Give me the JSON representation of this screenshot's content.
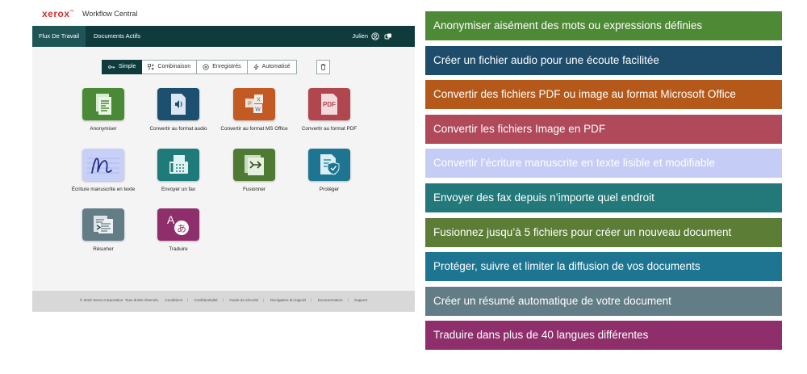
{
  "app": {
    "brand": "xerox",
    "brand_mark": "™",
    "product": "Workflow Central",
    "nav": {
      "tabs": [
        {
          "label": "Flux De Travail",
          "active": true
        },
        {
          "label": "Documents Actifs",
          "active": false
        }
      ],
      "user": "Julien",
      "user_icon": "user-circle-icon",
      "link_icon": "linked-account-icon"
    },
    "modes": [
      {
        "label": "Simple",
        "icon": "key-icon",
        "active": true
      },
      {
        "label": "Combinaison",
        "icon": "combine-icon",
        "active": false
      },
      {
        "label": "Enregistrés",
        "icon": "saved-icon",
        "active": false
      },
      {
        "label": "Automatisé",
        "icon": "lightning-icon",
        "active": false
      }
    ],
    "trash_icon": "trash-icon",
    "tiles": [
      {
        "label": "Anonymiser",
        "icon": "anonymize-document-icon",
        "color": "#4a8a36"
      },
      {
        "label": "Convertir au format audio",
        "icon": "audio-speaker-icon",
        "color": "#1d4f6e"
      },
      {
        "label": "Convertir au format MS Office",
        "icon": "ms-office-icon",
        "color": "#c35a23"
      },
      {
        "label": "Convertir au format PDF",
        "icon": "pdf-icon",
        "color": "#b0474f"
      },
      {
        "label": "Écriture manuscrite en texte",
        "icon": "handwriting-icon",
        "color": "#c9d0f7"
      },
      {
        "label": "Envoyer un fax",
        "icon": "fax-icon",
        "color": "#1f7b7a"
      },
      {
        "label": "Fusionner",
        "icon": "merge-icon",
        "color": "#4f7a33"
      },
      {
        "label": "Protéger",
        "icon": "protect-shield-icon",
        "color": "#1e7591"
      },
      {
        "label": "Résumer",
        "icon": "summarize-icon",
        "color": "#637d87"
      },
      {
        "label": "Traduire",
        "icon": "translate-icon",
        "color": "#8e2f6b"
      }
    ],
    "footer": {
      "copyright": "© 2023 Xerox Corporation. Tous droits réservés.",
      "links": [
        "Conditions",
        "Confidentialité",
        "Guide de sécurité",
        "Divulgation du logiciel",
        "Documentation",
        "Support"
      ]
    }
  },
  "legend": [
    {
      "text": "Anonymiser aisément des mots ou expressions définies",
      "color": "#4e8a36"
    },
    {
      "text": "Créer un fichier audio pour une écoute facilitée",
      "color": "#1d4d6b"
    },
    {
      "text": "Convertir des fichiers PDF ou image au format Microsoft Office",
      "color": "#b5591a"
    },
    {
      "text": "Convertir les fichiers Image en PDF",
      "color": "#b0495a"
    },
    {
      "text": "Convertir l’écriture manuscrite en texte lisible et modifiable",
      "color": "#c5cdf6"
    },
    {
      "text": "Envoyer des fax depuis n’importe quel endroit",
      "color": "#23797a"
    },
    {
      "text": "Fusionnez jusqu’à 5 fichiers pour créer un nouveau document",
      "color": "#5c7d35"
    },
    {
      "text": "Protéger, suivre et limiter la diffusion de vos documents",
      "color": "#1e7591"
    },
    {
      "text": "Créer un résumé automatique de votre document",
      "color": "#637d87"
    },
    {
      "text": "Traduire dans plus de 40 langues différentes",
      "color": "#8e2f6b"
    }
  ]
}
